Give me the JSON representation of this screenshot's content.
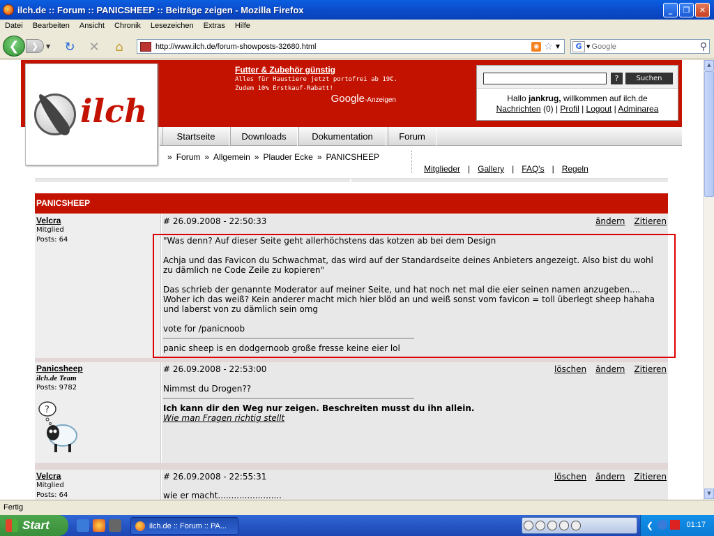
{
  "window": {
    "title": "ilch.de :: Forum :: PANICSHEEP :: Beiträge zeigen - Mozilla Firefox"
  },
  "menu": [
    "Datei",
    "Bearbeiten",
    "Ansicht",
    "Chronik",
    "Lesezeichen",
    "Extras",
    "Hilfe"
  ],
  "toolbar": {
    "url": "http://www.ilch.de/forum-showposts-32680.html",
    "search_placeholder": "Google"
  },
  "ad": {
    "headline": "Futter & Zubehör günstig",
    "line1": "Alles für Haustiere jetzt portofrei ab 19€.",
    "line2": "Zudem 10% Erstkauf-Rabatt!",
    "google": "Google",
    "anzeigen": "-Anzeigen"
  },
  "logo": {
    "text": "ilch"
  },
  "login": {
    "help": "?",
    "search": "Suchen",
    "hello_pre": "Hallo ",
    "user": "jankrug,",
    "hello_post": " willkommen auf ilch.de",
    "messages": "Nachrichten",
    "msg_count": " (0) | ",
    "profile": "Profil",
    "logout": "Logout",
    "admin": "Adminarea",
    "sep": " | "
  },
  "nav": [
    "Startseite",
    "Downloads",
    "Dokumentation",
    "Forum"
  ],
  "breadcrumb": [
    "»",
    "Forum",
    "»",
    "Allgemein",
    "»",
    "Plauder Ecke",
    "»",
    "PANICSHEEP"
  ],
  "sublinks": [
    "Mitglieder",
    "Gallery",
    "FAQ's",
    "Regeln"
  ],
  "sublinks_sep": "|",
  "topic": {
    "title": "PANICSHEEP"
  },
  "posts": [
    {
      "user": "Velcra",
      "role": "Mitglied",
      "posts": "Posts: 64",
      "date": "# 26.09.2008 - 22:50:33",
      "actions": [
        "ändern",
        "Zitieren"
      ],
      "paragraphs": [
        "\"Was denn? Auf dieser Seite geht allerhöchstens das kotzen ab bei dem Design",
        "Achja und das Favicon du Schwachmat, das wird auf der Standardseite deines Anbieters angezeigt. Also bist du wohl zu dämlich ne Code Zeile zu kopieren\"",
        "Das schrieb der genannte Moderator auf meiner Seite, und hat noch net mal die eier seinen namen anzugeben.... Woher ich das weiß? Kein anderer macht mich hier blöd an und weiß sonst vom favicon = toll überlegt sheep hahaha und laberst von zu dämlich sein omg",
        "vote for /panicnoob"
      ],
      "signature": "panic sheep is en dodgernoob große fresse keine eier lol"
    },
    {
      "user": "Panicsheep",
      "role": "ilch.de Team",
      "posts": "Posts: 9782",
      "date": "# 26.09.2008 - 22:53:00",
      "actions": [
        "löschen",
        "ändern",
        "Zitieren"
      ],
      "text": "Nimmst du Drogen??",
      "signature_bold": "Ich kann dir den Weg nur zeigen. Beschreiten musst du ihn allein.",
      "signature_link": "Wie man Fragen richtig stellt"
    },
    {
      "user": "Velcra",
      "role": "Mitglied",
      "posts": "Posts: 64",
      "date": "# 26.09.2008 - 22:55:31",
      "actions": [
        "löschen",
        "ändern",
        "Zitieren"
      ],
      "text": "wie er macht........................"
    }
  ],
  "status": "Fertig",
  "taskbar": {
    "start": "Start",
    "task": "ilch.de :: Forum :: PA...",
    "clock": "01:17"
  }
}
